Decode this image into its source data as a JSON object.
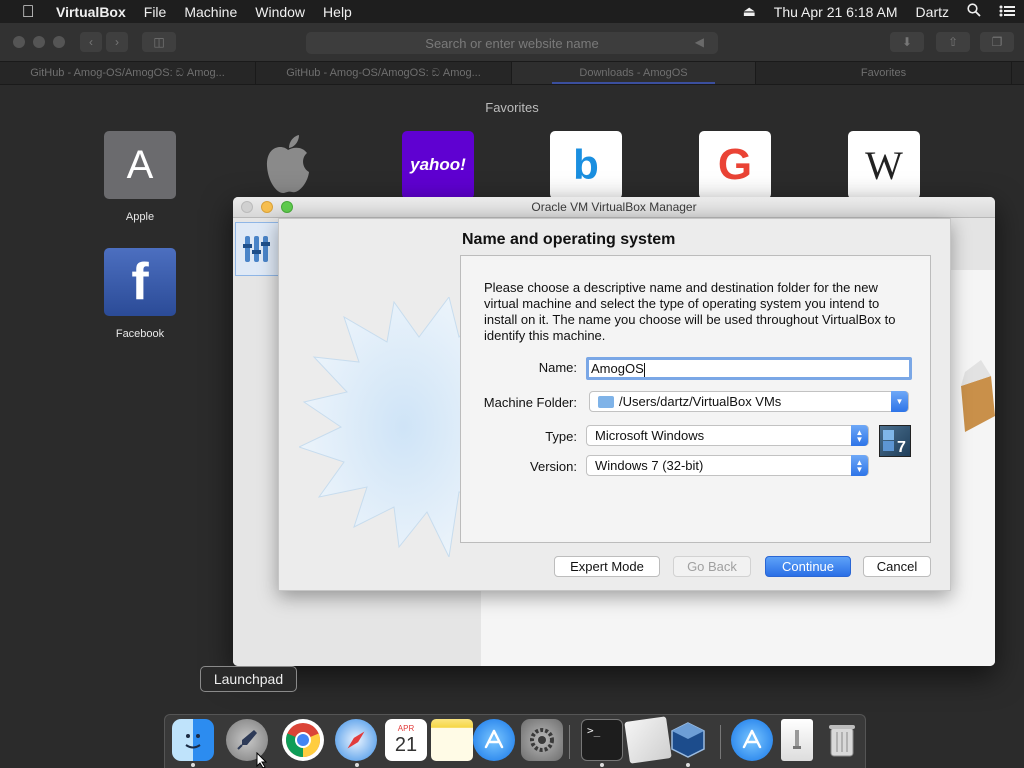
{
  "menubar": {
    "apple": "",
    "app_name": "VirtualBox",
    "menus": [
      "File",
      "Machine",
      "Window",
      "Help"
    ],
    "datetime": "Thu Apr 21  6:18 AM",
    "user": "Dartz"
  },
  "safari": {
    "url_placeholder": "Search or enter website name",
    "tabs": [
      "GitHub - Amog-OS/AmogOS: ඞ Amog...",
      "GitHub - Amog-OS/AmogOS: ඞ Amog...",
      "Downloads - AmogOS",
      "Favorites"
    ],
    "favorites_title": "Favorites",
    "favorites": [
      {
        "label": "Apple",
        "glyph": "A"
      },
      {
        "label": "",
        "glyph": ""
      },
      {
        "label": "",
        "glyph": "yahoo!"
      },
      {
        "label": "",
        "glyph": "b"
      },
      {
        "label": "",
        "glyph": "G"
      },
      {
        "label": "",
        "glyph": "W"
      },
      {
        "label": "Facebook",
        "glyph": "f"
      }
    ]
  },
  "vbox": {
    "window_title": "Oracle VM VirtualBox Manager",
    "wizard": {
      "title": "Name and operating system",
      "description": "Please choose a descriptive name and destination folder for the new virtual machine and select the type of operating system you intend to install on it. The name you choose will be used throughout VirtualBox to identify this machine.",
      "name_label": "Name:",
      "name_value": "AmogOS",
      "folder_label": "Machine Folder:",
      "folder_value": "/Users/dartz/VirtualBox VMs",
      "type_label": "Type:",
      "type_value": "Microsoft Windows",
      "version_label": "Version:",
      "version_value": "Windows 7 (32-bit)",
      "os_badge": "7",
      "buttons": {
        "expert": "Expert Mode",
        "back": "Go Back",
        "continue": "Continue",
        "cancel": "Cancel"
      }
    }
  },
  "dock": {
    "tooltip": "Launchpad",
    "calendar_month": "APR",
    "calendar_day": "21"
  },
  "colors": {
    "accent": "#2a6fe6",
    "menubar": "#1e1e1e",
    "desktop": "#2b2b2b"
  }
}
